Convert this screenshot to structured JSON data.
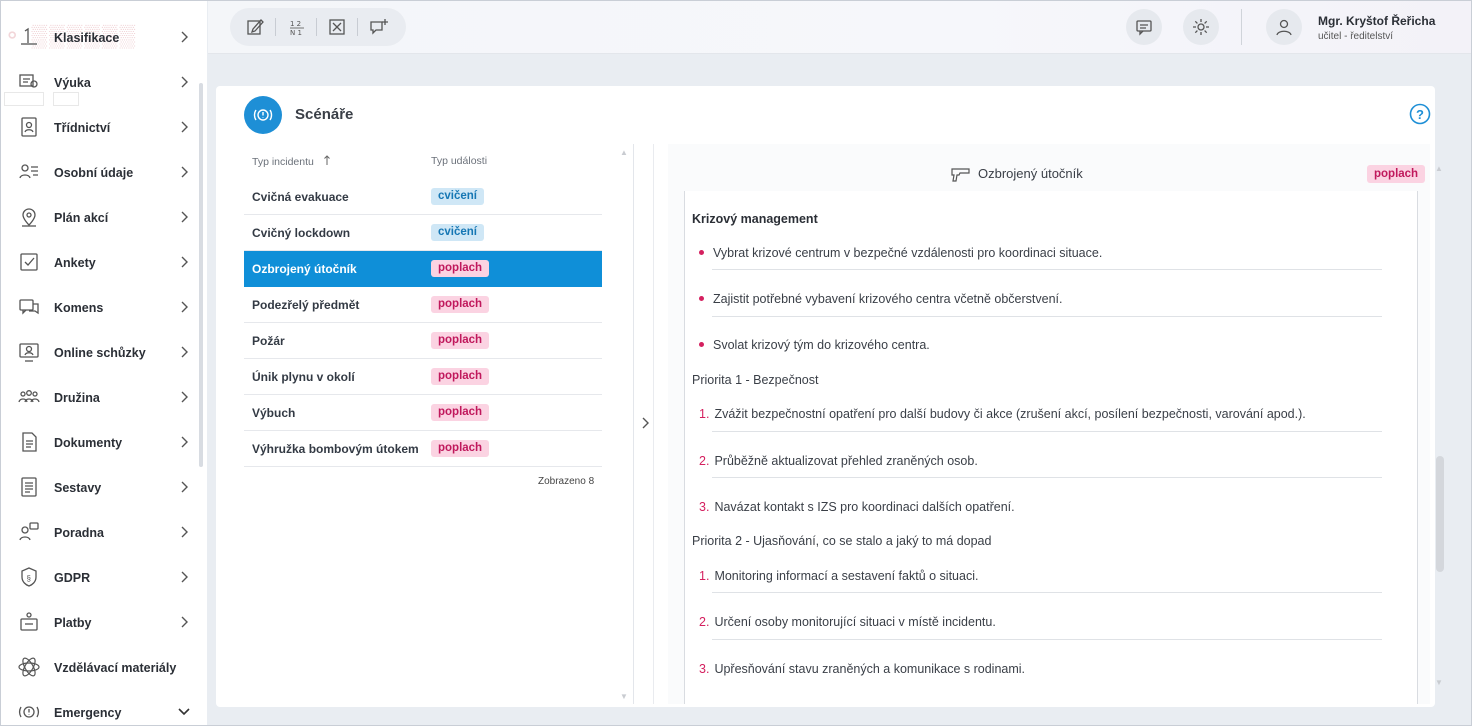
{
  "sidebar": {
    "items": [
      {
        "label": "Klasifikace",
        "icon": "grade-icon"
      },
      {
        "label": "Výuka",
        "icon": "teaching-icon"
      },
      {
        "label": "Třídnictví",
        "icon": "classroom-icon"
      },
      {
        "label": "Osobní údaje",
        "icon": "personal-data-icon"
      },
      {
        "label": "Plán akcí",
        "icon": "map-pin-icon"
      },
      {
        "label": "Ankety",
        "icon": "checkbox-icon"
      },
      {
        "label": "Komens",
        "icon": "chat-icon"
      },
      {
        "label": "Online schůzky",
        "icon": "video-meeting-icon"
      },
      {
        "label": "Družina",
        "icon": "group-icon"
      },
      {
        "label": "Dokumenty",
        "icon": "document-icon"
      },
      {
        "label": "Sestavy",
        "icon": "report-icon"
      },
      {
        "label": "Poradna",
        "icon": "counseling-icon"
      },
      {
        "label": "GDPR",
        "icon": "shield-icon"
      },
      {
        "label": "Platby",
        "icon": "payment-icon"
      },
      {
        "label": "Vzdělávací materiály",
        "icon": "atom-icon"
      },
      {
        "label": "Emergency",
        "icon": "emergency-icon"
      }
    ]
  },
  "user": {
    "name": "Mgr. Kryštof Řeřicha",
    "role": "učitel - ředitelství"
  },
  "page": {
    "title": "Scénáře"
  },
  "table": {
    "col_type": "Typ incidentu",
    "col_event": "Typ události",
    "rows": [
      {
        "name": "Cvičná evakuace",
        "event": "cvičení"
      },
      {
        "name": "Cvičný lockdown",
        "event": "cvičení"
      },
      {
        "name": "Ozbrojený útočník",
        "event": "poplach"
      },
      {
        "name": "Podezřelý předmět",
        "event": "poplach"
      },
      {
        "name": "Požár",
        "event": "poplach"
      },
      {
        "name": "Únik plynu v okolí",
        "event": "poplach"
      },
      {
        "name": "Výbuch",
        "event": "poplach"
      },
      {
        "name": "Výhružka bombovým útokem",
        "event": "poplach"
      }
    ],
    "shown": "Zobrazeno 8"
  },
  "detail": {
    "title": "Ozbrojený útočník",
    "badge": "poplach",
    "section_title": "Krizový management",
    "bullets": [
      "Vybrat krizové centrum v bezpečné vzdálenosti pro koordinaci situace.",
      "Zajistit potřebné vybavení krizového centra včetně občerstvení.",
      "Svolat krizový tým do krizového centra."
    ],
    "priority1": {
      "title": "Priorita 1 - Bezpečnost",
      "items": [
        "Zvážit bezpečnostní opatření pro další budovy či akce (zrušení akcí, posílení bezpečnosti, varování apod.).",
        "Průběžně aktualizovat přehled zraněných osob.",
        "Navázat kontakt s IZS pro koordinaci dalších opatření."
      ]
    },
    "priority2": {
      "title": "Priorita 2 - Ujasňování, co se stalo a jaký to má dopad",
      "items": [
        "Monitoring informací a sestavení faktů o situaci.",
        "Určení osoby monitorující situaci v místě incidentu.",
        "Upřesňování stavu zraněných a komunikace s rodinami."
      ]
    },
    "markers": [
      "1.",
      "2.",
      "3."
    ]
  }
}
